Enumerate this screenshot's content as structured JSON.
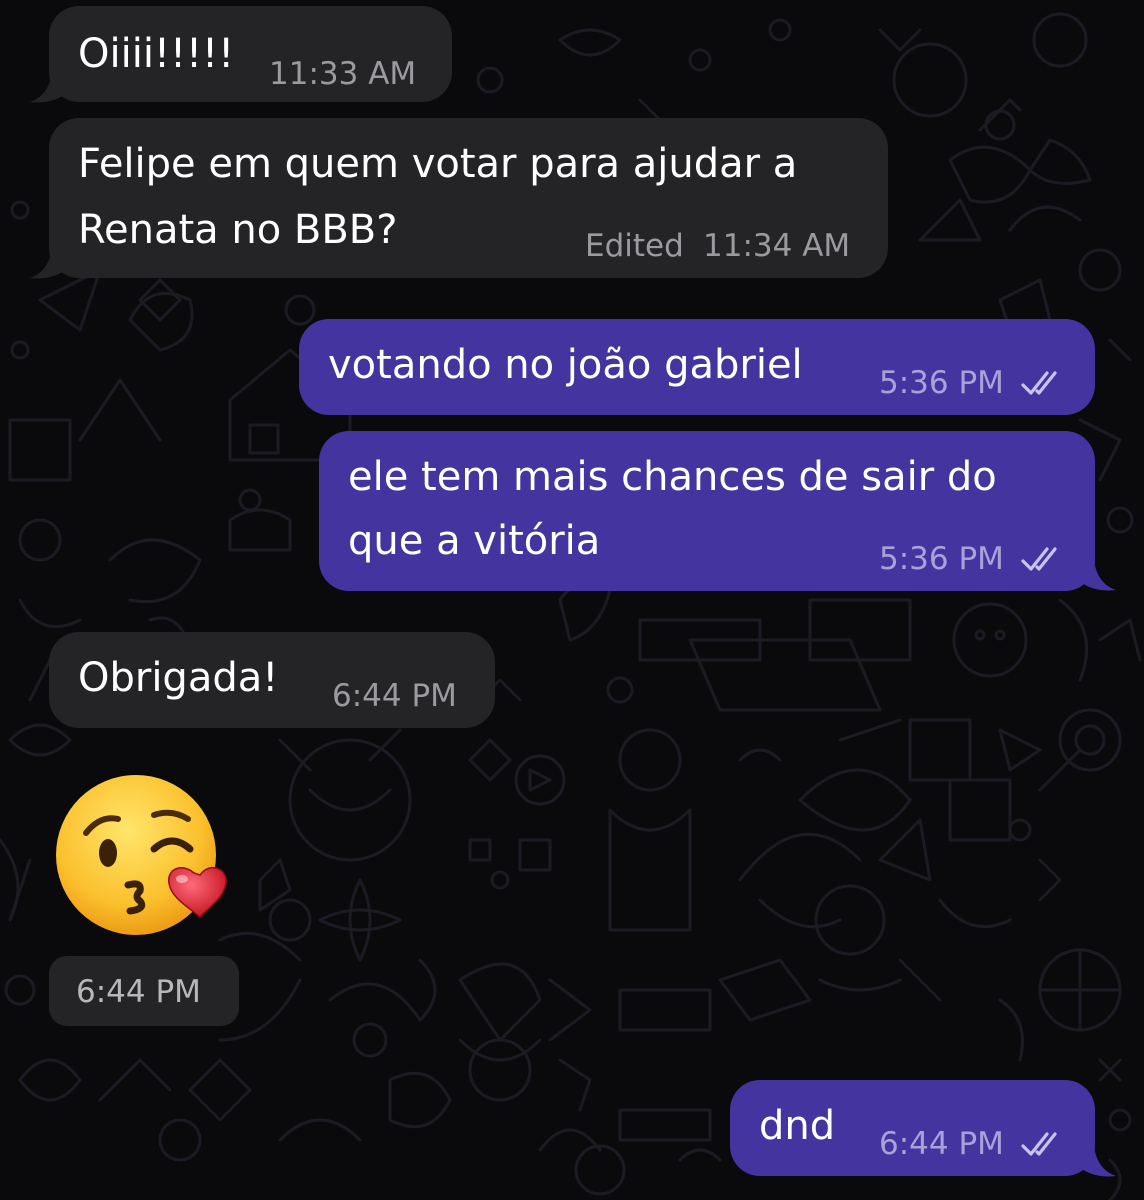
{
  "chat": {
    "messages": [
      {
        "direction": "in",
        "text": "Oiiii!!!!!",
        "time": "11:33 AM"
      },
      {
        "direction": "in",
        "lines": [
          "Felipe em quem votar para ajudar a",
          "Renata no BBB?"
        ],
        "edited_label": "Edited",
        "time": "11:34 AM"
      },
      {
        "direction": "out",
        "text": "votando no joão gabriel",
        "time": "5:36 PM",
        "status_icon": "double-check-read-icon"
      },
      {
        "direction": "out",
        "lines": [
          "ele tem mais chances de sair do",
          "que a vitória"
        ],
        "time": "5:36 PM",
        "status_icon": "double-check-read-icon"
      },
      {
        "direction": "in",
        "text": "Obrigada!",
        "time": "6:44 PM"
      },
      {
        "direction": "in",
        "type": "emoji",
        "emoji": "kissing-face-with-heart",
        "time": "6:44 PM"
      },
      {
        "direction": "out",
        "text": "dnd",
        "time": "6:44 PM",
        "status_icon": "double-check-read-icon"
      }
    ]
  },
  "colors": {
    "background": "#0a0a0c",
    "incoming_bubble": "#242426",
    "outgoing_bubble": "#43349f",
    "incoming_meta": "#9a9a9f",
    "outgoing_meta": "#a9a2d9"
  }
}
